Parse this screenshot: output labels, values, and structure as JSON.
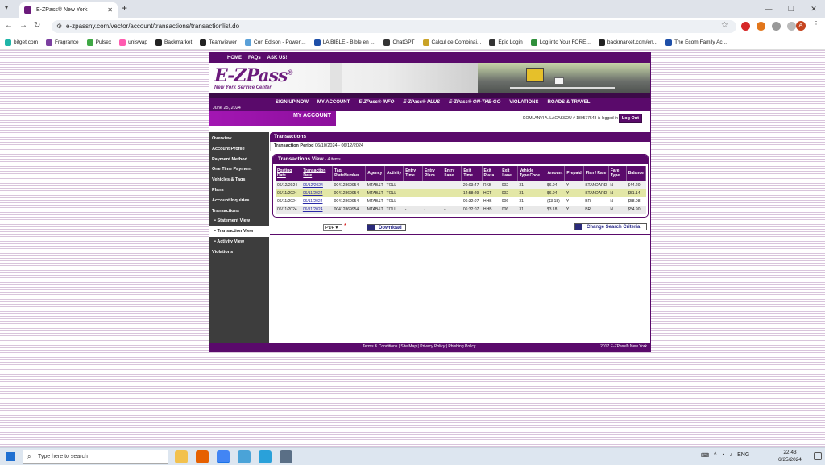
{
  "browser": {
    "tab_title": "E-ZPass® New York",
    "url": "e-zpassny.com/vector/account/transactions/transactionlist.do",
    "profile_initial": "A",
    "bookmarks": [
      "bitget.com",
      "Fragrance",
      "Pulsex",
      "uniswap",
      "Backmarket",
      "Teamviewer",
      "Con Edison - Poweri...",
      "LA BIBLE - Bible en l...",
      "ChatGPT",
      "Calcul de Combinai...",
      "Epic Login",
      "Log into Your FORE...",
      "backmarket.com/en...",
      "The Ecom Family Ac..."
    ]
  },
  "site": {
    "top_nav": [
      "HOME",
      "FAQs",
      "ASK US!"
    ],
    "logo": "E-ZPass",
    "logo_mark": "®",
    "logo_sub": "New York Service Center",
    "main_nav": [
      "SIGN UP NOW",
      "MY ACCOUNT",
      "E-ZPass® INFO",
      "E-ZPass® PLUS",
      "E-ZPass® ON-THE-GO",
      "VIOLATIONS",
      "ROADS & TRAVEL"
    ],
    "date": "June 25, 2024",
    "account_tab": "MY ACCOUNT",
    "logged_in_text": "KOMLANVI A. LAGASSOU # 180577548 is logged in",
    "logout": "Log Out"
  },
  "sidebar": [
    {
      "label": "Overview",
      "sub": false,
      "active": false
    },
    {
      "label": "Account Profile",
      "sub": false,
      "active": false
    },
    {
      "label": "Payment Method",
      "sub": false,
      "active": false
    },
    {
      "label": "One Time Payment",
      "sub": false,
      "active": false
    },
    {
      "label": "Vehicles & Tags",
      "sub": false,
      "active": false
    },
    {
      "label": "Plans",
      "sub": false,
      "active": false
    },
    {
      "label": "Account Inquiries",
      "sub": false,
      "active": false
    },
    {
      "label": "Transactions",
      "sub": false,
      "active": false
    },
    {
      "label": "• Statement View",
      "sub": true,
      "active": false
    },
    {
      "label": "• Transaction View",
      "sub": true,
      "active": true
    },
    {
      "label": "• Activity View",
      "sub": true,
      "active": false
    },
    {
      "label": "Violations",
      "sub": false,
      "active": false
    }
  ],
  "content": {
    "title": "Transactions",
    "period_label": "Transaction Period",
    "period_value": "06/10/2024 - 06/12/2024",
    "view_title": "Transactions View",
    "view_count": "- 4 items",
    "columns": [
      "Posting Date",
      "Transaction Date",
      "Tag/ PlateNumber",
      "Agency",
      "Activity",
      "Entry Time",
      "Entry Plaza",
      "Entry Lane",
      "Exit Time",
      "Exit Plaza",
      "Exit Lane",
      "Vehicle Type Code",
      "Amount",
      "Prepaid",
      "Plan / Rate",
      "Fare Type",
      "Balance"
    ],
    "rows": [
      [
        "06/12/2024",
        "06/12/2024",
        "00412869954",
        "MTAB&T",
        "TOLL",
        "-",
        "-",
        "-",
        "20:03:47",
        "RKB",
        "002",
        "31",
        "$6.94",
        "Y",
        "STANDARD",
        "N",
        "$44.20"
      ],
      [
        "06/11/2024",
        "06/11/2024",
        "00412869954",
        "MTAB&T",
        "TOLL",
        "-",
        "-",
        "-",
        "14:58:29",
        "HCT",
        "002",
        "31",
        "$6.94",
        "Y",
        "STANDARD",
        "N",
        "$51.14"
      ],
      [
        "06/11/2024",
        "06/11/2024",
        "00412869954",
        "MTAB&T",
        "TOLL",
        "-",
        "-",
        "-",
        "06:32:07",
        "HHB",
        "006",
        "31",
        "($3.18)",
        "Y",
        "BR",
        "N",
        "$58.08"
      ],
      [
        "06/11/2024",
        "06/11/2024",
        "00412869954",
        "MTAB&T",
        "TOLL",
        "-",
        "-",
        "-",
        "06:32:07",
        "HHB",
        "006",
        "31",
        "$3.18",
        "Y",
        "BR",
        "N",
        "$54.90"
      ]
    ],
    "format_select": "PDF",
    "required_mark": "*",
    "download": "Download",
    "change_search": "Change Search Criteria"
  },
  "footer": {
    "links": "Terms & Conditions  |  Site Map  |  Privacy Policy  |  Phishing Policy",
    "copyright": "2017 E-ZPass® New York"
  },
  "taskbar": {
    "search_placeholder": "Type here to search",
    "lang": "ENG",
    "time": "22:43",
    "date": "6/25/2024"
  }
}
